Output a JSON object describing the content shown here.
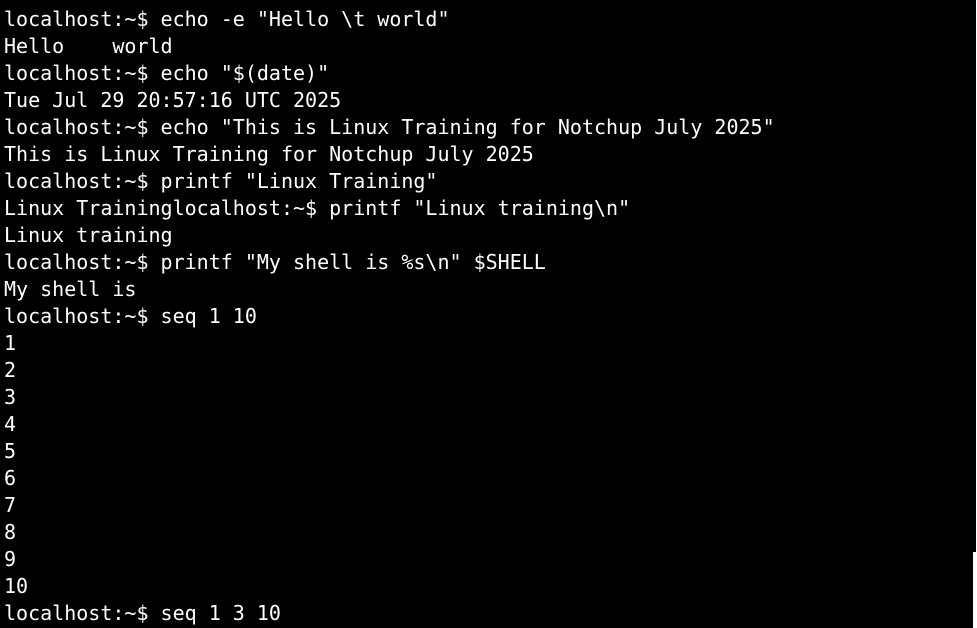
{
  "terminal": {
    "lines": [
      "localhost:~$ echo -e \"Hello \\t world\"",
      "Hello    world",
      "localhost:~$ echo \"$(date)\"",
      "Tue Jul 29 20:57:16 UTC 2025",
      "localhost:~$ echo \"This is Linux Training for Notchup July 2025\"",
      "This is Linux Training for Notchup July 2025",
      "localhost:~$ printf \"Linux Training\"",
      "Linux Traininglocalhost:~$ printf \"Linux training\\n\"",
      "Linux training",
      "localhost:~$ printf \"My shell is %s\\n\" $SHELL",
      "My shell is",
      "localhost:~$ seq 1 10",
      "1",
      "2",
      "3",
      "4",
      "5",
      "6",
      "7",
      "8",
      "9",
      "10",
      "localhost:~$ seq 1 3 10"
    ]
  },
  "colors": {
    "background": "#000000",
    "foreground": "#ffffff"
  }
}
